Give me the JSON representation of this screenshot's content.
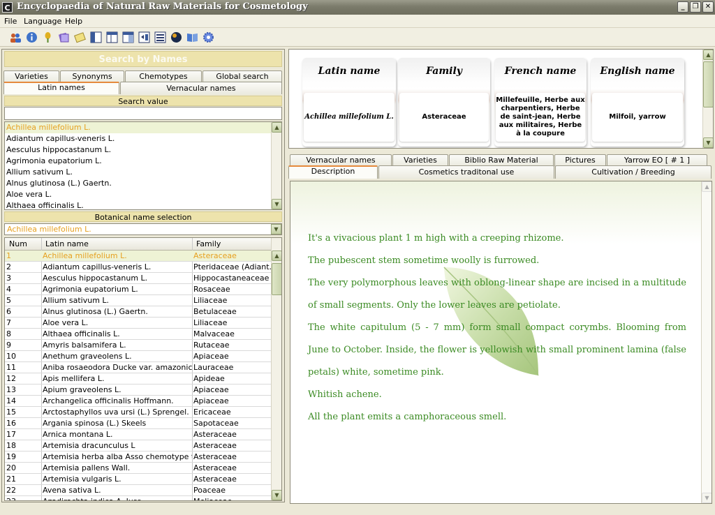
{
  "window": {
    "title": "Encyclopaedia of Natural Raw Materials for Cosmetology",
    "app_icon": "C",
    "minimize": "_",
    "maximize": "❐",
    "close": "✕"
  },
  "menu": {
    "file": "File",
    "language": "Language",
    "help": "Help"
  },
  "toolbar": {
    "icons": [
      "users-icon",
      "info-icon",
      "plant-icon",
      "cards-icon",
      "notes-icon",
      "layout-left-icon",
      "layout-split-icon",
      "layout-right-icon",
      "layout-panel-icon",
      "globe-icon",
      "book-icon",
      "settings-icon"
    ]
  },
  "left": {
    "search_banner": "Search by Names",
    "tabs_row1": [
      "Varieties",
      "Synonyms",
      "Chemotypes",
      "Global search"
    ],
    "tabs_row2": [
      "Latin names",
      "Vernacular names"
    ],
    "search_value_label": "Search value",
    "search_value": "",
    "name_list": [
      "Achillea millefolium L.",
      "Adiantum capillus-veneris L.",
      "Aesculus hippocastanum L.",
      "Agrimonia eupatorium L.",
      "Allium sativum L.",
      "Alnus glutinosa (L.) Gaertn.",
      "Aloe vera L.",
      "Althaea officinalis L."
    ],
    "botanical_selection_label": "Botanical name selection",
    "botanical_selection_value": "Achillea millefolium L.",
    "grid": {
      "headers": [
        "Num",
        "Latin name",
        "Family"
      ],
      "rows": [
        [
          "1",
          "Achillea millefolium L.",
          "Asteraceae"
        ],
        [
          "2",
          "Adiantum capillus-veneris L.",
          "Pteridaceae (Adiant..."
        ],
        [
          "3",
          "Aesculus hippocastanum L.",
          "Hippocastaneaceae"
        ],
        [
          "4",
          "Agrimonia eupatorium L.",
          "Rosaceae"
        ],
        [
          "5",
          "Allium sativum L.",
          "Liliaceae"
        ],
        [
          "6",
          "Alnus glutinosa (L.) Gaertn.",
          "Betulaceae"
        ],
        [
          "7",
          "Aloe vera L.",
          "Liliaceae"
        ],
        [
          "8",
          "Althaea officinalis L.",
          "Malvaceae"
        ],
        [
          "9",
          "Amyris balsamifera L.",
          "Rutaceae"
        ],
        [
          "10",
          "Anethum graveolens L.",
          "Apiaceae"
        ],
        [
          "11",
          "Aniba rosaeodora Ducke var. amazonica",
          "Lauraceae"
        ],
        [
          "12",
          "Apis mellifera L.",
          "Apideae"
        ],
        [
          "13",
          "Apium graveolens L.",
          "Apiaceae"
        ],
        [
          "14",
          "Archangelica officinalis Hoffmann.",
          "Apiaceae"
        ],
        [
          "15",
          "Arctostaphyllos uva ursi (L.) Sprengel.",
          "Ericaceae"
        ],
        [
          "16",
          "Argania spinosa (L.) Skeels",
          "Sapotaceae"
        ],
        [
          "17",
          "Arnica montana L.",
          "Asteraceae"
        ],
        [
          "18",
          "Artemisia dracunculus L",
          "Asteraceae"
        ],
        [
          "19",
          "Artemisia herba alba Asso chemotype thu...",
          "Asteraceae"
        ],
        [
          "20",
          "Artemisia pallens Wall.",
          "Asteraceae"
        ],
        [
          "21",
          "Artemisia vulgaris L.",
          "Asteraceae"
        ],
        [
          "22",
          "Avena sativa L.",
          "Poaceae"
        ],
        [
          "23",
          "Azadirachta indica A. Juss.",
          "Meliaceae"
        ]
      ]
    }
  },
  "info": {
    "cards": [
      {
        "header": "Latin name",
        "value": "Achillea millefolium L."
      },
      {
        "header": "Family",
        "value": "Asteraceae"
      },
      {
        "header": "French name",
        "value": "Millefeuille, Herbe aux charpentiers, Herbe de saint-jean, Herbe aux militaires, Herbe à la coupure"
      },
      {
        "header": "English name",
        "value": "Milfoil, yarrow"
      }
    ]
  },
  "right": {
    "tabs_row1": [
      "Vernacular names",
      "Varieties",
      "Biblio Raw Material",
      "Pictures",
      "Yarrow EO [ # 1 ]"
    ],
    "tabs_row2": [
      "Description",
      "Cosmetics traditonal use",
      "Cultivation / Breeding"
    ],
    "description": [
      "It's a vivacious plant 1 m high with a creeping rhizome.",
      "The pubescent stem sometime woolly is furrowed.",
      "The very polymorphous leaves with oblong-linear shape are incised in a multitude of small segments. Only the lower leaves are petiolate.",
      "The white capitulum (5 - 7 mm) form small compact corymbs. Blooming from June to October. Inside, the flower is yellowish with small prominent lamina (false petals) white, sometime pink.",
      "Whitish achene.",
      "All the plant emits a camphoraceous smell."
    ]
  },
  "colors": {
    "accent_tab": "#e58a3c",
    "selected_text": "#e6a020",
    "description_text": "#3a8a22",
    "banner_bg": "#ede3ac"
  }
}
